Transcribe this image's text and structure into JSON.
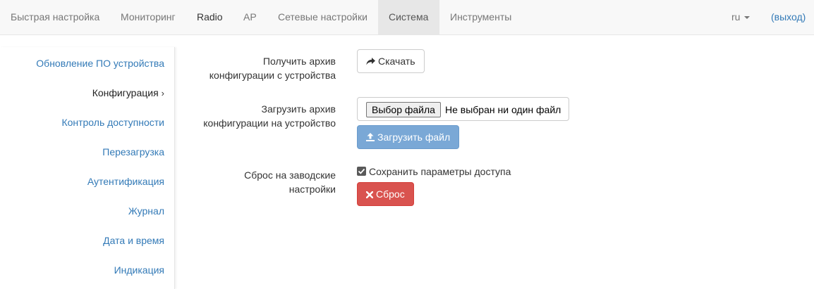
{
  "navbar": {
    "items": [
      {
        "label": "Быстрая настройка"
      },
      {
        "label": "Мониторинг"
      },
      {
        "label": "Radio"
      },
      {
        "label": "AP"
      },
      {
        "label": "Сетевые настройки"
      },
      {
        "label": "Система"
      },
      {
        "label": "Инструменты"
      }
    ],
    "active": "Система",
    "lang": "ru",
    "logout": "(выход)"
  },
  "sidebar": {
    "items": [
      {
        "label": "Обновление ПО устройства"
      },
      {
        "label": "Конфигурация"
      },
      {
        "label": "Контроль доступности"
      },
      {
        "label": "Перезагрузка"
      },
      {
        "label": "Аутентификация"
      },
      {
        "label": "Журнал"
      },
      {
        "label": "Дата и время"
      },
      {
        "label": "Индикация"
      }
    ],
    "active": "Конфигурация",
    "active_marker": "›"
  },
  "config": {
    "download": {
      "label_line1": "Получить архив",
      "label_line2": "конфигурации с устройства",
      "button": "Скачать",
      "icon": "share-arrow-icon"
    },
    "upload": {
      "label_line1": "Загрузить архив",
      "label_line2": "конфигурации на устройство",
      "file_button": "Выбор файла",
      "file_status": "Не выбран ни один файл",
      "button": "Загрузить файл",
      "icon": "upload-icon"
    },
    "reset": {
      "label_line1": "Сброс на заводские",
      "label_line2": "настройки",
      "checkbox_label": "Сохранить параметры доступа",
      "checkbox_checked": true,
      "button": "Сброс",
      "icon": "close-icon"
    }
  },
  "colors": {
    "link": "#337ab7",
    "primary_disabled": "#7aa8d6",
    "danger": "#d9534f",
    "navbar_bg": "#f8f8f8",
    "navbar_active_bg": "#e7e7e7"
  }
}
